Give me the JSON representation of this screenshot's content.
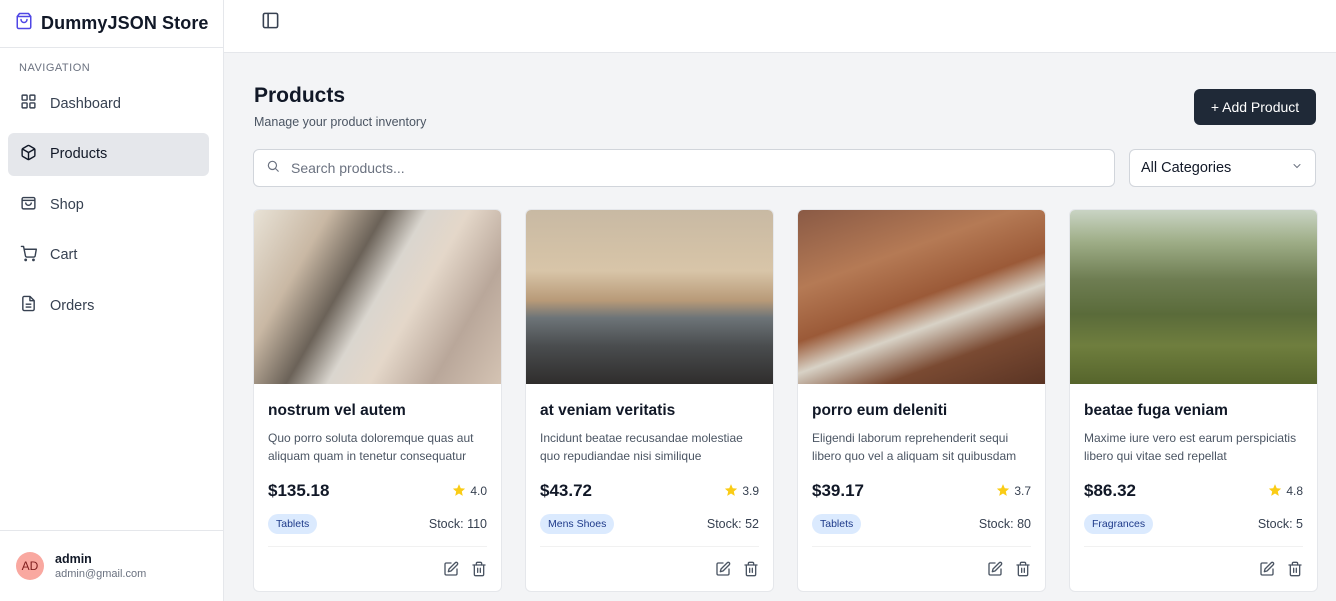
{
  "brand": {
    "title": "DummyJSON Store"
  },
  "nav": {
    "heading": "NAVIGATION",
    "items": [
      {
        "label": "Dashboard",
        "icon": "grid-icon"
      },
      {
        "label": "Products",
        "icon": "box-icon",
        "active": true
      },
      {
        "label": "Shop",
        "icon": "shopping-bag-icon"
      },
      {
        "label": "Cart",
        "icon": "cart-icon"
      },
      {
        "label": "Orders",
        "icon": "file-icon"
      }
    ]
  },
  "user": {
    "initials": "AD",
    "name": "admin",
    "email": "admin@gmail.com"
  },
  "page": {
    "title": "Products",
    "subtitle": "Manage your product inventory",
    "add_label": "+ Add Product"
  },
  "search": {
    "placeholder": "Search products..."
  },
  "category_filter": {
    "selected": "All Categories"
  },
  "products": [
    {
      "name": "nostrum vel autem",
      "description": "Quo porro soluta doloremque quas aut aliquam quam in tenetur consequatur",
      "price": "$135.18",
      "rating": "4.0",
      "category": "Tablets",
      "stock": "Stock: 110"
    },
    {
      "name": "at veniam veritatis",
      "description": "Incidunt beatae recusandae molestiae quo repudiandae nisi similique",
      "price": "$43.72",
      "rating": "3.9",
      "category": "Mens Shoes",
      "stock": "Stock: 52"
    },
    {
      "name": "porro eum deleniti",
      "description": "Eligendi laborum reprehenderit sequi libero quo vel a aliquam sit quibusdam",
      "price": "$39.17",
      "rating": "3.7",
      "category": "Tablets",
      "stock": "Stock: 80"
    },
    {
      "name": "beatae fuga veniam",
      "description": "Maxime iure vero est earum perspiciatis libero qui vitae sed repellat",
      "price": "$86.32",
      "rating": "4.8",
      "category": "Fragrances",
      "stock": "Stock: 5"
    }
  ],
  "colors": {
    "accent": "#1f2937",
    "brand_icon": "#4f46e5",
    "star": "#facc15",
    "badge_bg": "#dbeafe"
  }
}
